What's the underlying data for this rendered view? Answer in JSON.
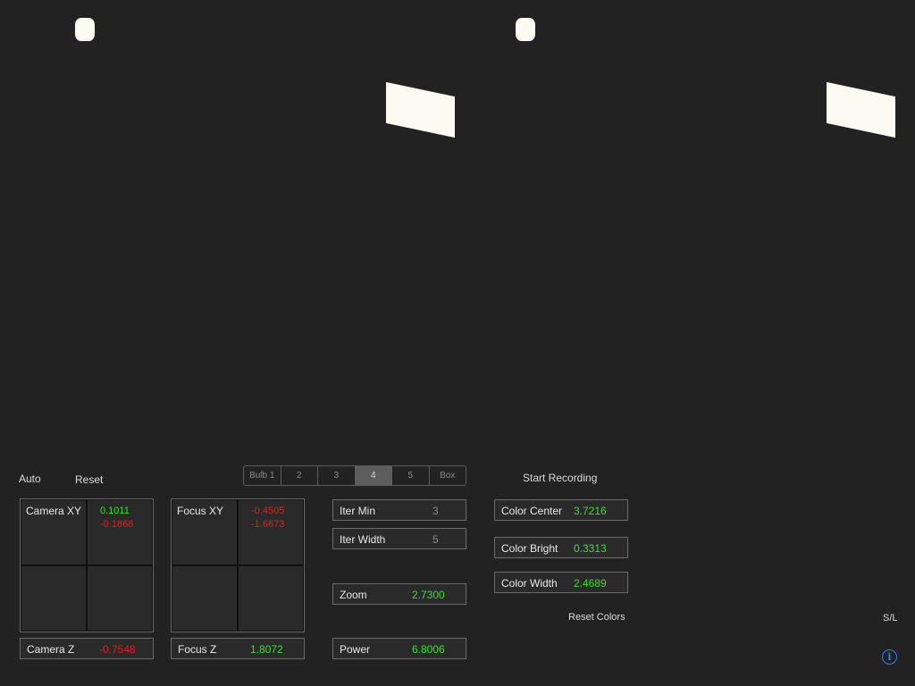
{
  "toolbar": {
    "auto_label": "Auto",
    "reset_label": "Reset",
    "start_recording_label": "Start Recording"
  },
  "segments": [
    "Bulb 1",
    "2",
    "3",
    "4",
    "5",
    "Box"
  ],
  "selected_segment": "4",
  "camera_xy": {
    "label": "Camera XY",
    "x": "0.1011",
    "y": "-0.1868"
  },
  "focus_xy": {
    "label": "Focus XY",
    "x": "-0.4505",
    "y": "-1.6673"
  },
  "camera_z": {
    "label": "Camera Z",
    "value": "-0.7548"
  },
  "focus_z": {
    "label": "Focus Z",
    "value": "1.8072"
  },
  "iter_min": {
    "label": "Iter Min",
    "value": "3"
  },
  "iter_width": {
    "label": "Iter Width",
    "value": "5"
  },
  "zoom": {
    "label": "Zoom",
    "value": "2.7300"
  },
  "power": {
    "label": "Power",
    "value": "6.8006"
  },
  "color_center": {
    "label": "Color Center",
    "value": "3.7216"
  },
  "color_bright": {
    "label": "Color Bright",
    "value": "0.3313"
  },
  "color_width": {
    "label": "Color Width",
    "value": "2.4689"
  },
  "reset_colors_label": "Reset Colors",
  "sl_label": "S/L",
  "info_glyph": "i",
  "colors": {
    "positive": "#39e02a",
    "negative": "#e02020",
    "info": "#2f7fe8"
  }
}
